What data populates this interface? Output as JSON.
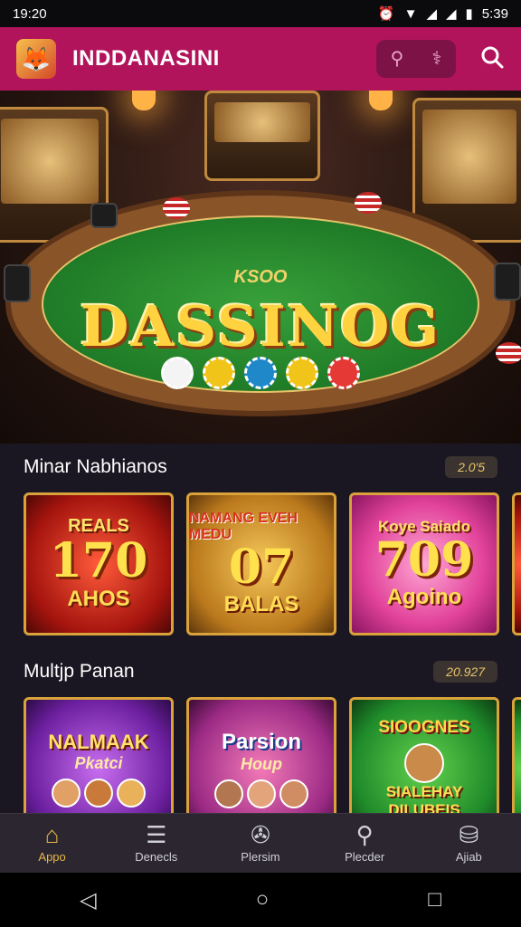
{
  "status_bar": {
    "time": "19:20",
    "right_time": "5:39"
  },
  "app_bar": {
    "title": "INDDANASINI"
  },
  "hero": {
    "small_title": "KSOO",
    "title": "DASSINOG"
  },
  "sections": [
    {
      "title": "Minar Nabhianos",
      "badge": "2.0'5",
      "cards": [
        {
          "top": "REALS",
          "big": "170",
          "bottom": "AHOS"
        },
        {
          "top": "NAMANG EVEH MEDU",
          "big": "07",
          "bottom": "BALAS"
        },
        {
          "top": "Koye Saiado",
          "big": "709",
          "bottom": "Agoino"
        }
      ]
    },
    {
      "title": "Multjp Panan",
      "badge": "20.927",
      "cards": [
        {
          "top": "NALMAAK",
          "mid": "Pkatci"
        },
        {
          "top": "Parsion",
          "mid": "Houp"
        },
        {
          "top": "SIOOGNES",
          "bottom": "SIALEHAY DILUBEIS"
        }
      ]
    }
  ],
  "bottom_nav": [
    {
      "label": "Appo",
      "icon": "home-icon",
      "active": true
    },
    {
      "label": "Denecls",
      "icon": "list-icon",
      "active": false
    },
    {
      "label": "Plersim",
      "icon": "settings-circle-icon",
      "active": false
    },
    {
      "label": "Plecder",
      "icon": "search-icon",
      "active": false
    },
    {
      "label": "Ajiab",
      "icon": "chip-stack-icon",
      "active": false
    }
  ],
  "colors": {
    "app_bar": "#b2145c",
    "accent_gold": "#e9b949",
    "background": "#1b1722"
  }
}
